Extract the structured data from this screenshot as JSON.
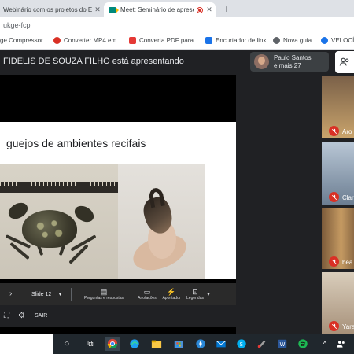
{
  "browser": {
    "tabs": [
      {
        "title": "Webinário com os projetos do E",
        "active": false
      },
      {
        "title": "Meet: Seminário de apresent",
        "active": true
      }
    ],
    "close_symbol": "✕",
    "new_tab_symbol": "+",
    "url": "ukge-fcp",
    "bookmarks": [
      {
        "label": "ge Compressor...",
        "icon": "bookmark-icon",
        "color": "#f5b400"
      },
      {
        "label": "Converter MP4 em...",
        "icon": "converter-icon",
        "color": "#d93025"
      },
      {
        "label": "Converta PDF para...",
        "icon": "pdf-heart-icon",
        "color": "#e53935"
      },
      {
        "label": "Encurtador de link",
        "icon": "link-icon",
        "color": "#1a73e8"
      },
      {
        "label": "Nova guia",
        "icon": "globe-icon",
        "color": "#5f6368"
      },
      {
        "label": "VELOCÍM",
        "icon": "speed-icon",
        "color": "#1a73e8"
      }
    ]
  },
  "meet": {
    "presenting_text": "FIDELIS DE SOUZA FILHO está apresentando",
    "presenter": {
      "name": "Paulo Santos",
      "others": "e mais 27"
    },
    "people_icon": "people-icon",
    "slide": {
      "title": "guejos de ambientes recifais"
    },
    "controls": {
      "slide_label": "Slide 12",
      "items": [
        {
          "label": "Perguntas e respostas",
          "icon": "qa-icon",
          "glyph": "▤"
        },
        {
          "label": "Anotações",
          "icon": "notes-icon",
          "glyph": "▭"
        },
        {
          "label": "Apontador",
          "icon": "pointer-icon",
          "glyph": "⚡"
        },
        {
          "label": "Legendas",
          "icon": "captions-icon",
          "glyph": "⊡"
        }
      ],
      "exit_label": "SAIR"
    },
    "participants": [
      {
        "name": "Aro"
      },
      {
        "name": "Clar"
      },
      {
        "name": "bea"
      },
      {
        "name": "Yara"
      }
    ]
  },
  "colors": {
    "meet_bg": "#202124",
    "mute_red": "#d93025",
    "tab_strip": "#dee1e6"
  }
}
